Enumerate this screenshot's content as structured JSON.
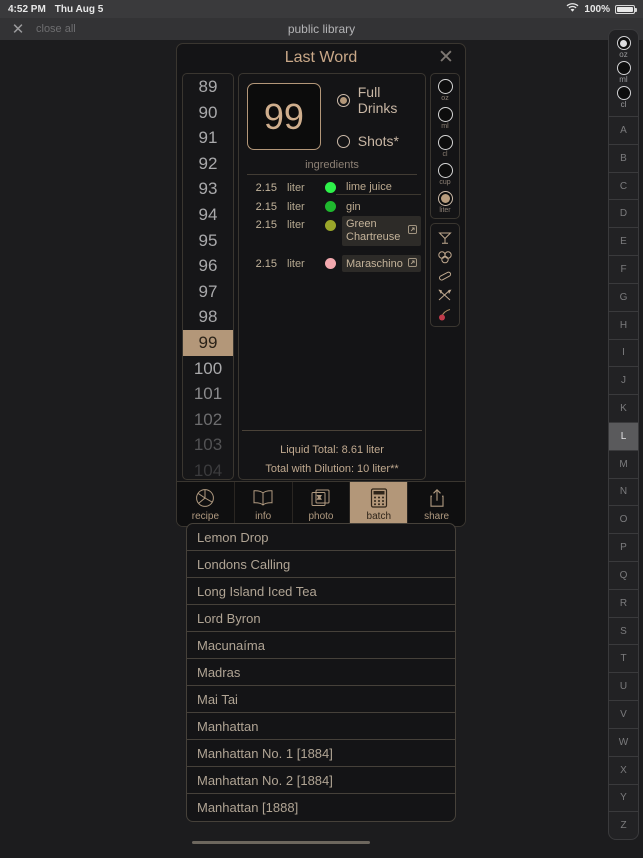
{
  "status_bar": {
    "time": "4:52 PM",
    "date": "Thu Aug 5",
    "battery_percent": "100%",
    "wifi_icon": "wifi-icon",
    "battery_icon": "battery-icon"
  },
  "tab_bar": {
    "close_icon": "close-icon",
    "close_all_label": "close all",
    "title": "public library"
  },
  "card": {
    "title": "Last Word",
    "close_icon": "close-icon",
    "number_picker": {
      "selected": "99",
      "values": [
        "89",
        "90",
        "91",
        "92",
        "93",
        "94",
        "95",
        "96",
        "97",
        "98",
        "99",
        "100",
        "101",
        "102",
        "103",
        "104"
      ]
    },
    "quantity": "99",
    "serving_options": [
      {
        "label": "Full Drinks",
        "selected": true
      },
      {
        "label": "Shots*",
        "selected": false
      }
    ],
    "ingredients_header": "ingredients",
    "ingredients": [
      {
        "amount": "2.15",
        "unit": "liter",
        "color": "#2ef24a",
        "name": "lime juice",
        "chip": false,
        "link": false
      },
      {
        "amount": "2.15",
        "unit": "liter",
        "color": "#1fb82e",
        "name": "gin",
        "chip": false,
        "link": false
      },
      {
        "amount": "2.15",
        "unit": "liter",
        "color": "#9aa62a",
        "name": "Green Chartreuse",
        "chip": true,
        "link": true
      },
      {
        "amount": "2.15",
        "unit": "liter",
        "color": "#f2a8ae",
        "name": "Maraschino",
        "chip": true,
        "link": true
      }
    ],
    "link_icon": "external-link-icon",
    "totals": [
      "Liquid Total: 8.61 liter",
      "Total with Dilution: 10 liter**"
    ],
    "unit_rail": [
      {
        "label": "oz",
        "selected": false
      },
      {
        "label": "ml",
        "selected": false
      },
      {
        "label": "cl",
        "selected": false
      },
      {
        "label": "cup",
        "selected": false
      },
      {
        "label": "liter",
        "selected": true
      }
    ],
    "tool_rail": [
      {
        "icon": "cocktail-glass-icon"
      },
      {
        "icon": "ice-cubes-icon"
      },
      {
        "icon": "garnish-peel-icon"
      },
      {
        "icon": "bar-tools-icon"
      },
      {
        "icon": "cherry-icon"
      }
    ],
    "toolbar": [
      {
        "label": "recipe",
        "icon": "pie-chart-icon",
        "active": false
      },
      {
        "label": "info",
        "icon": "book-icon",
        "active": false
      },
      {
        "label": "photo",
        "icon": "photos-icon",
        "active": false
      },
      {
        "label": "batch",
        "icon": "calculator-icon",
        "active": true
      },
      {
        "label": "share",
        "icon": "share-icon",
        "active": false
      }
    ]
  },
  "drink_list": [
    "Lemon Drop",
    "Londons Calling",
    "Long Island Iced Tea",
    "Lord Byron",
    "Macunaíma",
    "Madras",
    "Mai Tai",
    "Manhattan",
    "Manhattan No. 1 [1884]",
    "Manhattan No. 2 [1884]",
    "Manhattan [1888]"
  ],
  "index_rail": {
    "units": [
      {
        "label": "oz",
        "selected": true
      },
      {
        "label": "ml",
        "selected": false
      },
      {
        "label": "cl",
        "selected": false
      }
    ],
    "letters": [
      "A",
      "B",
      "C",
      "D",
      "E",
      "F",
      "G",
      "H",
      "I",
      "J",
      "K",
      "L",
      "M",
      "N",
      "O",
      "P",
      "Q",
      "R",
      "S",
      "T",
      "U",
      "V",
      "W",
      "X",
      "Y",
      "Z"
    ],
    "selected_letter": "L"
  },
  "colors": {
    "accent": "#b39779",
    "card_bg": "#141416",
    "page_bg": "#1c1c1e"
  }
}
